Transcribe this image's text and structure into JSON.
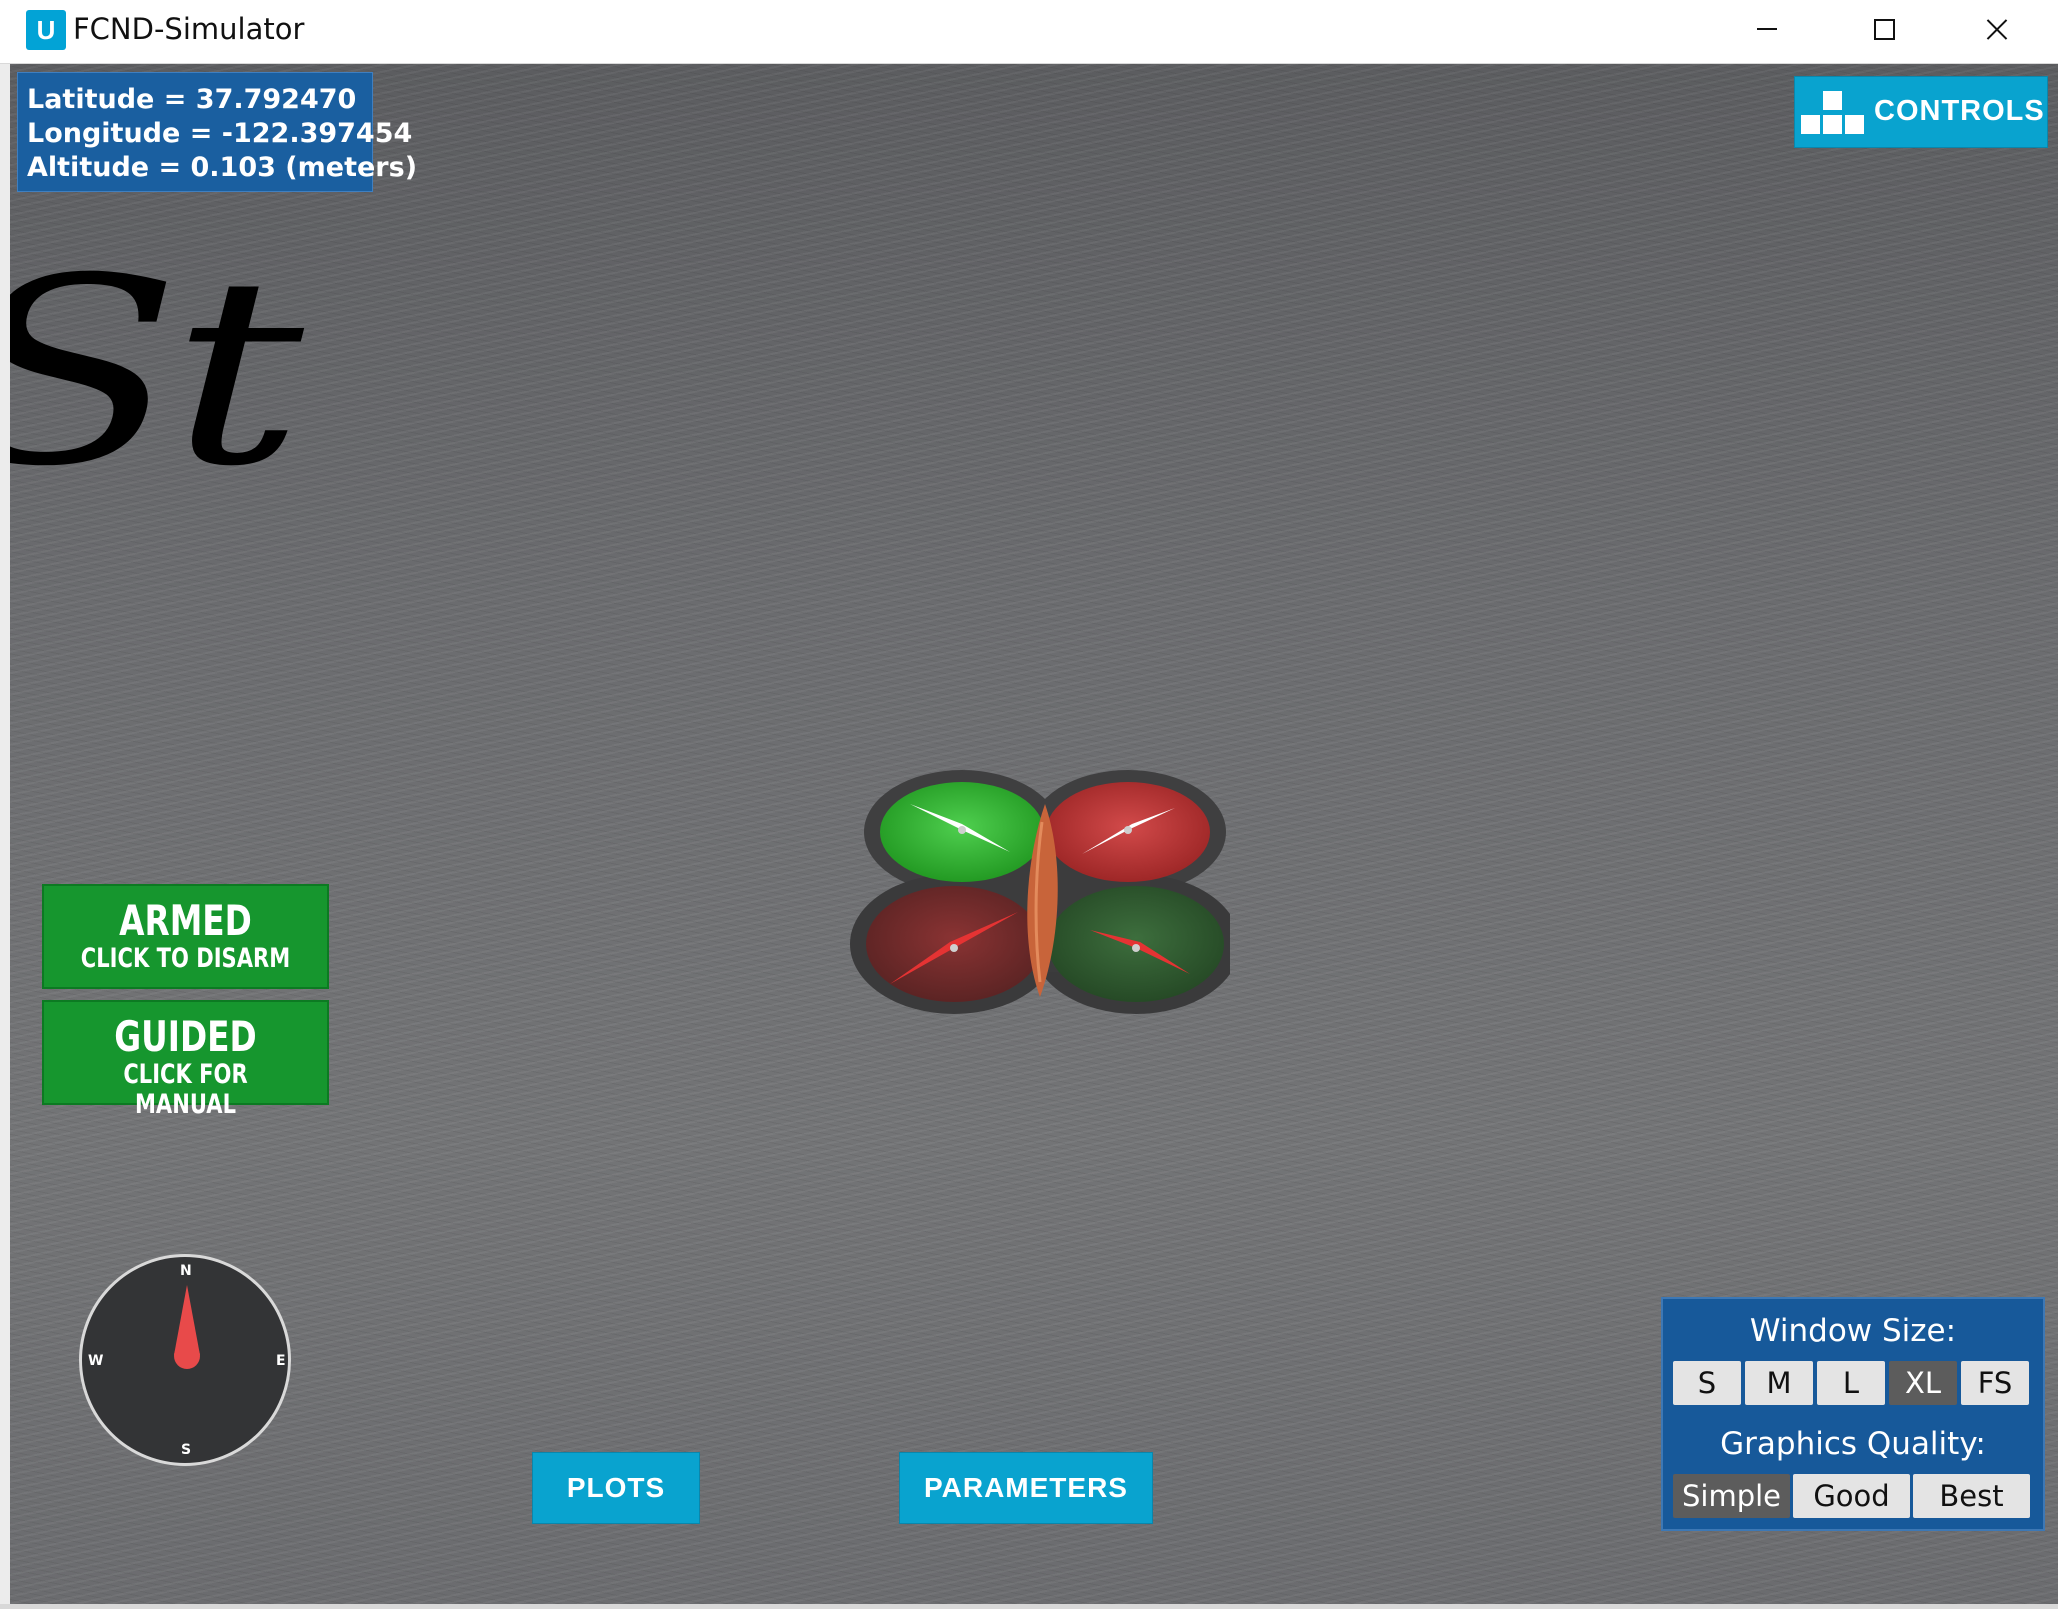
{
  "window": {
    "title": "FCND-Simulator",
    "app_icon_glyph": "U"
  },
  "gps": {
    "latitude": "Latitude = 37.792470",
    "longitude": "Longitude = -122.397454",
    "altitude": "Altitude = 0.103 (meters)"
  },
  "scene": {
    "ground_text": "St"
  },
  "controls_button": {
    "label": "CONTROLS",
    "icon": "controls-blocks-icon"
  },
  "mode_buttons": {
    "armed": {
      "title": "ARMED",
      "subtitle": "CLICK TO DISARM"
    },
    "guided": {
      "title": "GUIDED",
      "subtitle": "CLICK FOR MANUAL"
    }
  },
  "compass": {
    "north": "N",
    "south": "S",
    "west": "W",
    "east": "E"
  },
  "bottom_buttons": {
    "plots": "PLOTS",
    "parameters": "PARAMETERS"
  },
  "settings": {
    "window_size_label": "Window Size:",
    "window_sizes": [
      "S",
      "M",
      "L",
      "XL",
      "FS"
    ],
    "active_window_size": "XL",
    "graphics_quality_label": "Graphics Quality:",
    "qualities": [
      "Simple",
      "Good",
      "Best"
    ],
    "active_quality": "Simple"
  },
  "colors": {
    "panel_blue": "#1a5fa0",
    "button_cyan": "#09a3cf",
    "mode_green": "#16962e",
    "compass_needle": "#e84a4a"
  }
}
